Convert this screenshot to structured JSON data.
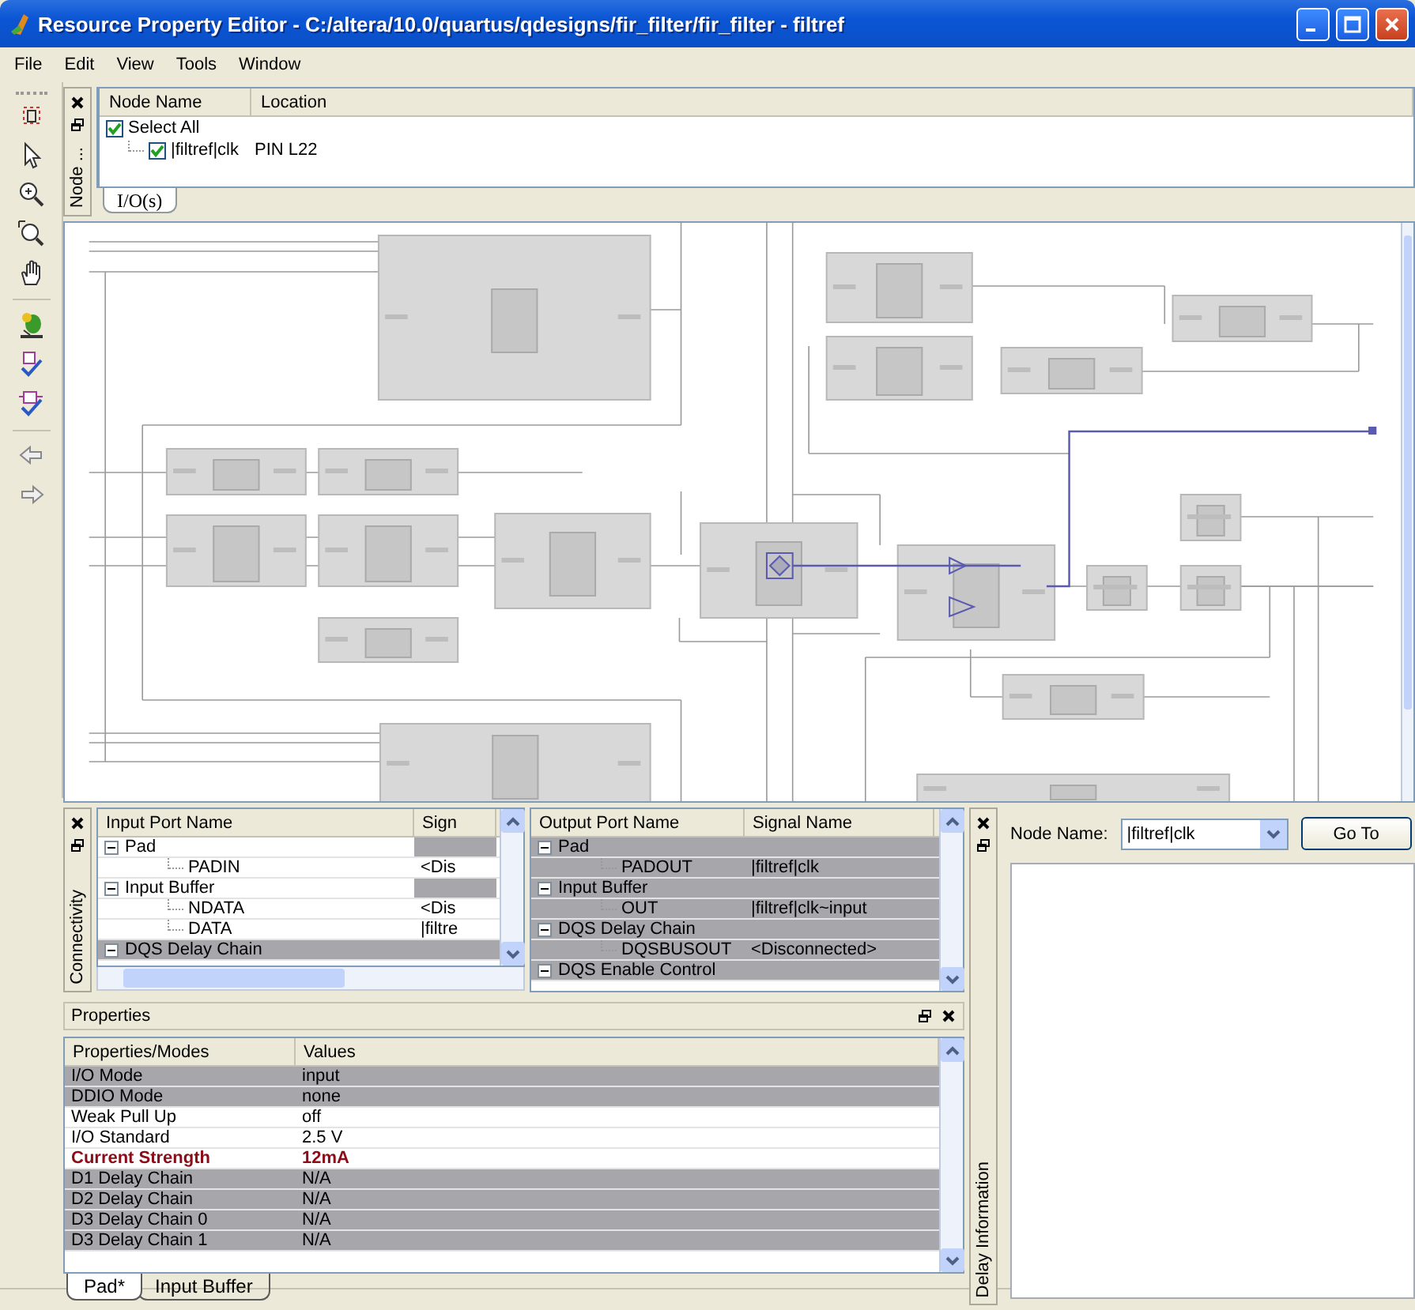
{
  "window": {
    "title": "Resource Property Editor - C:/altera/10.0/quartus/qdesigns/fir_filter/fir_filter - filtref"
  },
  "menu": [
    "File",
    "Edit",
    "View",
    "Tools",
    "Window"
  ],
  "node_panel": {
    "label": "Node ...",
    "columns": [
      "Node Name",
      "Location"
    ],
    "rows": [
      {
        "name": "Select All",
        "checked": true,
        "children": [
          {
            "name": "|filtref|clk",
            "location": "PIN L22",
            "checked": true
          }
        ]
      }
    ],
    "tabs": [
      {
        "label": "I/O(s)",
        "selected": true
      }
    ]
  },
  "connectivity": {
    "label": "Connectivity",
    "input_ports": {
      "columns": [
        "Input Port Name",
        "Sign"
      ],
      "rows": [
        {
          "name": "Pad",
          "kind": "group",
          "expanded": true,
          "shaded": false,
          "children": [
            {
              "name": "PADIN",
              "kind": "port",
              "signal": "<Dis",
              "shaded": false
            }
          ]
        },
        {
          "name": "Input Buffer",
          "kind": "group",
          "expanded": true,
          "shaded": false,
          "children": [
            {
              "name": "NDATA",
              "kind": "port",
              "signal": "<Dis",
              "shaded": false
            },
            {
              "name": "DATA",
              "kind": "port",
              "signal": "|filtre",
              "shaded": false
            }
          ]
        },
        {
          "name": "DQS Delay Chain",
          "kind": "group",
          "expanded": true,
          "shaded": true
        }
      ]
    },
    "output_ports": {
      "columns": [
        "Output Port Name",
        "Signal Name"
      ],
      "rows": [
        {
          "name": "Pad",
          "kind": "group",
          "expanded": true,
          "shaded": true,
          "children": [
            {
              "name": "PADOUT",
              "kind": "port",
              "signal": "|filtref|clk",
              "shaded": true
            }
          ]
        },
        {
          "name": "Input Buffer",
          "kind": "group",
          "expanded": true,
          "shaded": true,
          "children": [
            {
              "name": "OUT",
              "kind": "port",
              "signal": "|filtref|clk~input",
              "shaded": true
            }
          ]
        },
        {
          "name": "DQS Delay Chain",
          "kind": "group",
          "expanded": true,
          "shaded": true,
          "children": [
            {
              "name": "DQSBUSOUT",
              "kind": "port",
              "signal": "<Disconnected>",
              "shaded": true
            }
          ]
        },
        {
          "name": "DQS Enable Control",
          "kind": "group",
          "expanded": true,
          "shaded": true
        }
      ]
    }
  },
  "properties": {
    "title": "Properties",
    "columns": [
      "Properties/Modes",
      "Values"
    ],
    "rows": [
      {
        "property": "I/O Mode",
        "value": "input",
        "shaded": true,
        "modified": false
      },
      {
        "property": "DDIO Mode",
        "value": "none",
        "shaded": true,
        "modified": false
      },
      {
        "property": "Weak Pull Up",
        "value": "off",
        "shaded": false,
        "modified": false
      },
      {
        "property": "I/O Standard",
        "value": "2.5 V",
        "shaded": false,
        "modified": false
      },
      {
        "property": "Current Strength",
        "value": "12mA",
        "shaded": false,
        "modified": true
      },
      {
        "property": "D1 Delay Chain",
        "value": "N/A",
        "shaded": true,
        "modified": false
      },
      {
        "property": "D2 Delay Chain",
        "value": "N/A",
        "shaded": true,
        "modified": false
      },
      {
        "property": "D3 Delay Chain 0",
        "value": "N/A",
        "shaded": true,
        "modified": false
      },
      {
        "property": "D3 Delay Chain 1",
        "value": "N/A",
        "shaded": true,
        "modified": false
      }
    ],
    "tabs": [
      {
        "label": "Pad*",
        "selected": true
      },
      {
        "label": "Input Buffer",
        "selected": false
      }
    ]
  },
  "delay_information": {
    "label": "Delay Information",
    "node_name_label": "Node Name:",
    "node_name": {
      "value": "|filtref|clk"
    },
    "button": "Go To"
  }
}
